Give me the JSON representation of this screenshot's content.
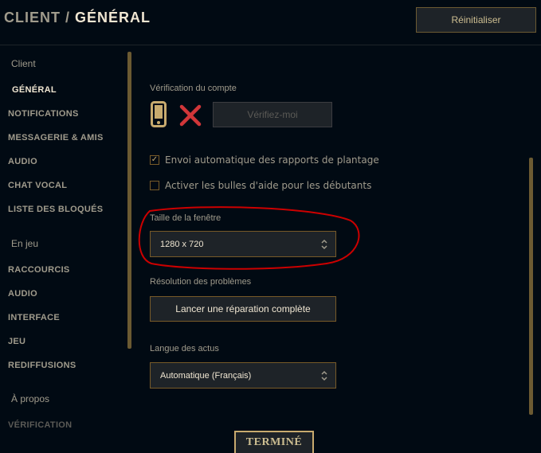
{
  "header": {
    "crumb": "CLIENT",
    "separator": "/",
    "current": "GÉNÉRAL",
    "reset_label": "Réinitialiser"
  },
  "sidebar": {
    "client_section": "Client",
    "client_items": [
      "GÉNÉRAL",
      "NOTIFICATIONS",
      "MESSAGERIE & AMIS",
      "AUDIO",
      "CHAT VOCAL",
      "LISTE DES BLOQUÉS"
    ],
    "game_section": "En jeu",
    "game_items": [
      "RACCOURCIS",
      "AUDIO",
      "INTERFACE",
      "JEU",
      "REDIFFUSIONS"
    ],
    "about_section": "À propos",
    "about_items": [
      "VÉRIFICATION"
    ],
    "active_item": "GÉNÉRAL"
  },
  "main": {
    "account_verification_label": "Vérification du compte",
    "verify_button": "Vérifiez-moi",
    "checkboxes": [
      {
        "label": "Envoi automatique des rapports de plantage",
        "checked": true
      },
      {
        "label": "Activer les bulles d'aide pour les débutants",
        "checked": false
      }
    ],
    "window_size_label": "Taille de la fenêtre",
    "window_size_value": "1280 x 720",
    "troubleshoot_label": "Résolution des problèmes",
    "repair_button": "Lancer une réparation complète",
    "news_language_label": "Langue des actus",
    "news_language_value": "Automatique (Français)"
  },
  "footer": {
    "done_label": "TERMINÉ"
  },
  "colors": {
    "background": "#010a13",
    "gold": "#c8aa6e",
    "gold_dark": "#785a28",
    "text": "#a09b8c",
    "text_bright": "#f0e6d2",
    "annotation_red": "#cc0000",
    "x_red": "#d13639"
  },
  "icons": {
    "phone": "phone-icon",
    "not_verified": "x-icon",
    "select_arrows": "chevron-updown-icon",
    "check": "checkmark-icon"
  }
}
